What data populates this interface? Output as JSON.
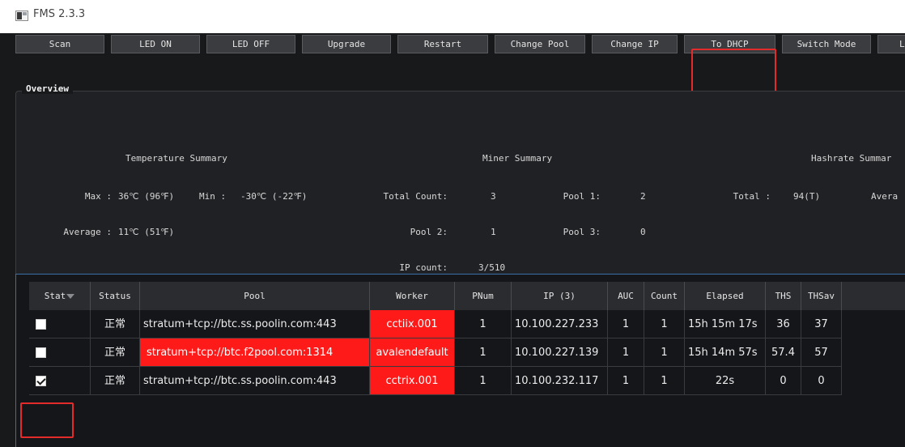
{
  "window": {
    "title": "FMS 2.3.3"
  },
  "toolbar": {
    "buttons": [
      "Scan",
      "LED ON",
      "LED OFF",
      "Upgrade",
      "Restart",
      "Change Pool",
      "Change IP",
      "To DHCP",
      "Switch Mode",
      "L"
    ]
  },
  "overview": {
    "title": "Overview",
    "temperature": {
      "header": "Temperature Summary",
      "max_label": "Max :",
      "max_value": "36℃ (96℉)",
      "min_label": "Min :",
      "min_value": "-30℃ (-22℉)",
      "avg_label": "Average :",
      "avg_value": "11℃ (51℉)"
    },
    "miner": {
      "header": "Miner Summary",
      "total_count_label": "Total Count:",
      "total_count_value": "3",
      "pool1_label": "Pool 1:",
      "pool1_value": "2",
      "pool2_label": "Pool 2:",
      "pool2_value": "1",
      "pool3_label": "Pool 3:",
      "pool3_value": "0",
      "ip_count_label": "IP count:",
      "ip_count_value": "3/510"
    },
    "hashrate": {
      "header": "Hashrate Summar",
      "total_label": "Total :",
      "total_value": "94(T)",
      "avg_label": "Avera"
    }
  },
  "table": {
    "headers": [
      "Stat",
      "Status",
      "Pool",
      "Worker",
      "PNum",
      "IP (3)",
      "AUC",
      "Count",
      "Elapsed",
      "THS",
      "THSav"
    ],
    "rows": [
      {
        "checked": false,
        "status": "正常",
        "pool": "stratum+tcp://btc.ss.poolin.com:443",
        "worker": "cctiix.001",
        "pnum": "1",
        "ip": "10.100.227.233",
        "auc": "1",
        "count": "1",
        "elapsed": "15h 15m 17s",
        "ths": "36",
        "thsav": "37"
      },
      {
        "checked": false,
        "status": "正常",
        "pool": "stratum+tcp://btc.f2pool.com:1314",
        "worker": "avalendefault",
        "pnum": "1",
        "ip": "10.100.227.139",
        "auc": "1",
        "count": "1",
        "elapsed": "15h 14m 57s",
        "ths": "57.4",
        "thsav": "57"
      },
      {
        "checked": true,
        "status": "正常",
        "pool": "stratum+tcp://btc.ss.poolin.com:443",
        "worker": "cctrix.001",
        "pnum": "1",
        "ip": "10.100.232.117",
        "auc": "1",
        "count": "1",
        "elapsed": "22s",
        "ths": "0",
        "thsav": "0"
      }
    ]
  },
  "colors": {
    "highlight": "#e42b2b",
    "alert_cell": "#ff1a1a",
    "background": "#18191b"
  }
}
